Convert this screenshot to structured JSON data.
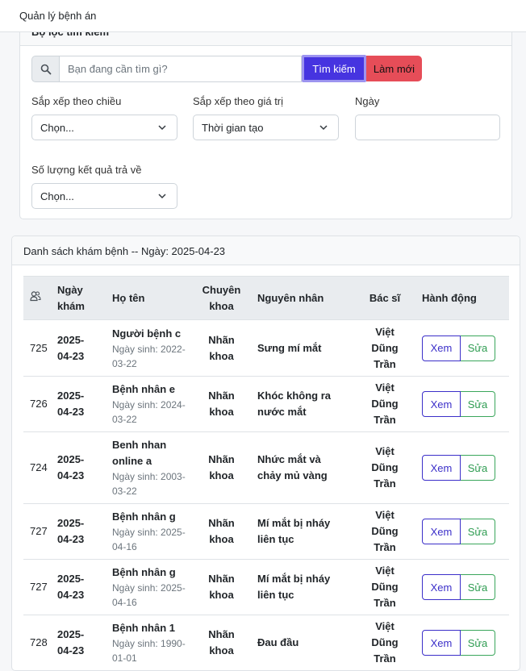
{
  "topbar": {
    "title": "Quản lý bệnh án"
  },
  "filter": {
    "title": "Bộ lọc tìm kiếm",
    "search": {
      "placeholder": "Bạn đang cần tìm gì?",
      "value": ""
    },
    "search_button": "Tìm kiếm",
    "reset_button": "Làm mới",
    "sort_dir_label": "Sắp xếp theo chiều",
    "sort_dir_value": "Chọn...",
    "sort_val_label": "Sắp xếp theo giá trị",
    "sort_val_value": "Thời gian tạo",
    "date_label": "Ngày",
    "date_value": "",
    "limit_label": "Số lượng kết quả trả về",
    "limit_value": "Chọn..."
  },
  "list": {
    "title": "Danh sách khám bệnh -- Ngày: 2025-04-23",
    "headers": {
      "id_icon": "users-icon",
      "date": "Ngày khám",
      "name": "Họ tên",
      "specialty": "Chuyên khoa",
      "cause": "Nguyên nhân",
      "doctor": "Bác sĩ",
      "action": "Hành động"
    },
    "view_label": "Xem",
    "edit_label": "Sửa",
    "rows": [
      {
        "id": "725",
        "date": "2025-04-23",
        "name": "Người bệnh c",
        "dob": "Ngày sinh: 2022-03-22",
        "specialty": "Nhãn khoa",
        "cause": "Sưng mí mắt",
        "doctor": "Việt Dũng Trần"
      },
      {
        "id": "726",
        "date": "2025-04-23",
        "name": "Bệnh nhân e",
        "dob": "Ngày sinh: 2024-03-22",
        "specialty": "Nhãn khoa",
        "cause": "Khóc không ra nước mắt",
        "doctor": "Việt Dũng Trần"
      },
      {
        "id": "724",
        "date": "2025-04-23",
        "name": "Benh nhan online a",
        "dob": "Ngày sinh: 2003-03-22",
        "specialty": "Nhãn khoa",
        "cause": "Nhức mắt và chảy mủ vàng",
        "doctor": "Việt Dũng Trần"
      },
      {
        "id": "727",
        "date": "2025-04-23",
        "name": "Bệnh nhân g",
        "dob": "Ngày sinh: 2025-04-16",
        "specialty": "Nhãn khoa",
        "cause": "Mí mắt bị nháy liên tục",
        "doctor": "Việt Dũng Trần"
      },
      {
        "id": "727",
        "date": "2025-04-23",
        "name": "Bệnh nhân g",
        "dob": "Ngày sinh: 2025-04-16",
        "specialty": "Nhãn khoa",
        "cause": "Mí mắt bị nháy liên tục",
        "doctor": "Việt Dũng Trần"
      },
      {
        "id": "728",
        "date": "2025-04-23",
        "name": "Bệnh nhân 1",
        "dob": "Ngày sinh: 1990-01-01",
        "specialty": "Nhãn khoa",
        "cause": "Đau đầu",
        "doctor": "Việt Dũng Trần"
      }
    ]
  }
}
